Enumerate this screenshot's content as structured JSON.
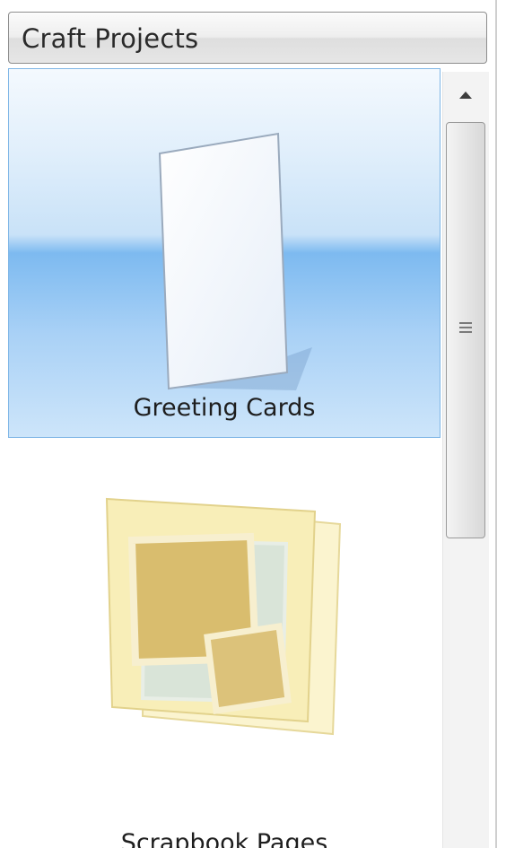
{
  "panel": {
    "title": "Craft Projects"
  },
  "items": [
    {
      "label": "Greeting Cards",
      "icon": "greeting-card-icon",
      "selected": true
    },
    {
      "label": "Scrapbook Pages",
      "icon": "scrapbook-pages-icon",
      "selected": false
    }
  ],
  "colors": {
    "selection_border": "#7fb6e6",
    "selection_fill": "#a9d1f6",
    "scrapbook_paper": "#f8eeb8",
    "scrapbook_photo": "#d9bd6e"
  },
  "scrollbar": {
    "up_icon": "scroll-up-arrow-icon",
    "thumb_icon": "scroll-grip-icon"
  }
}
